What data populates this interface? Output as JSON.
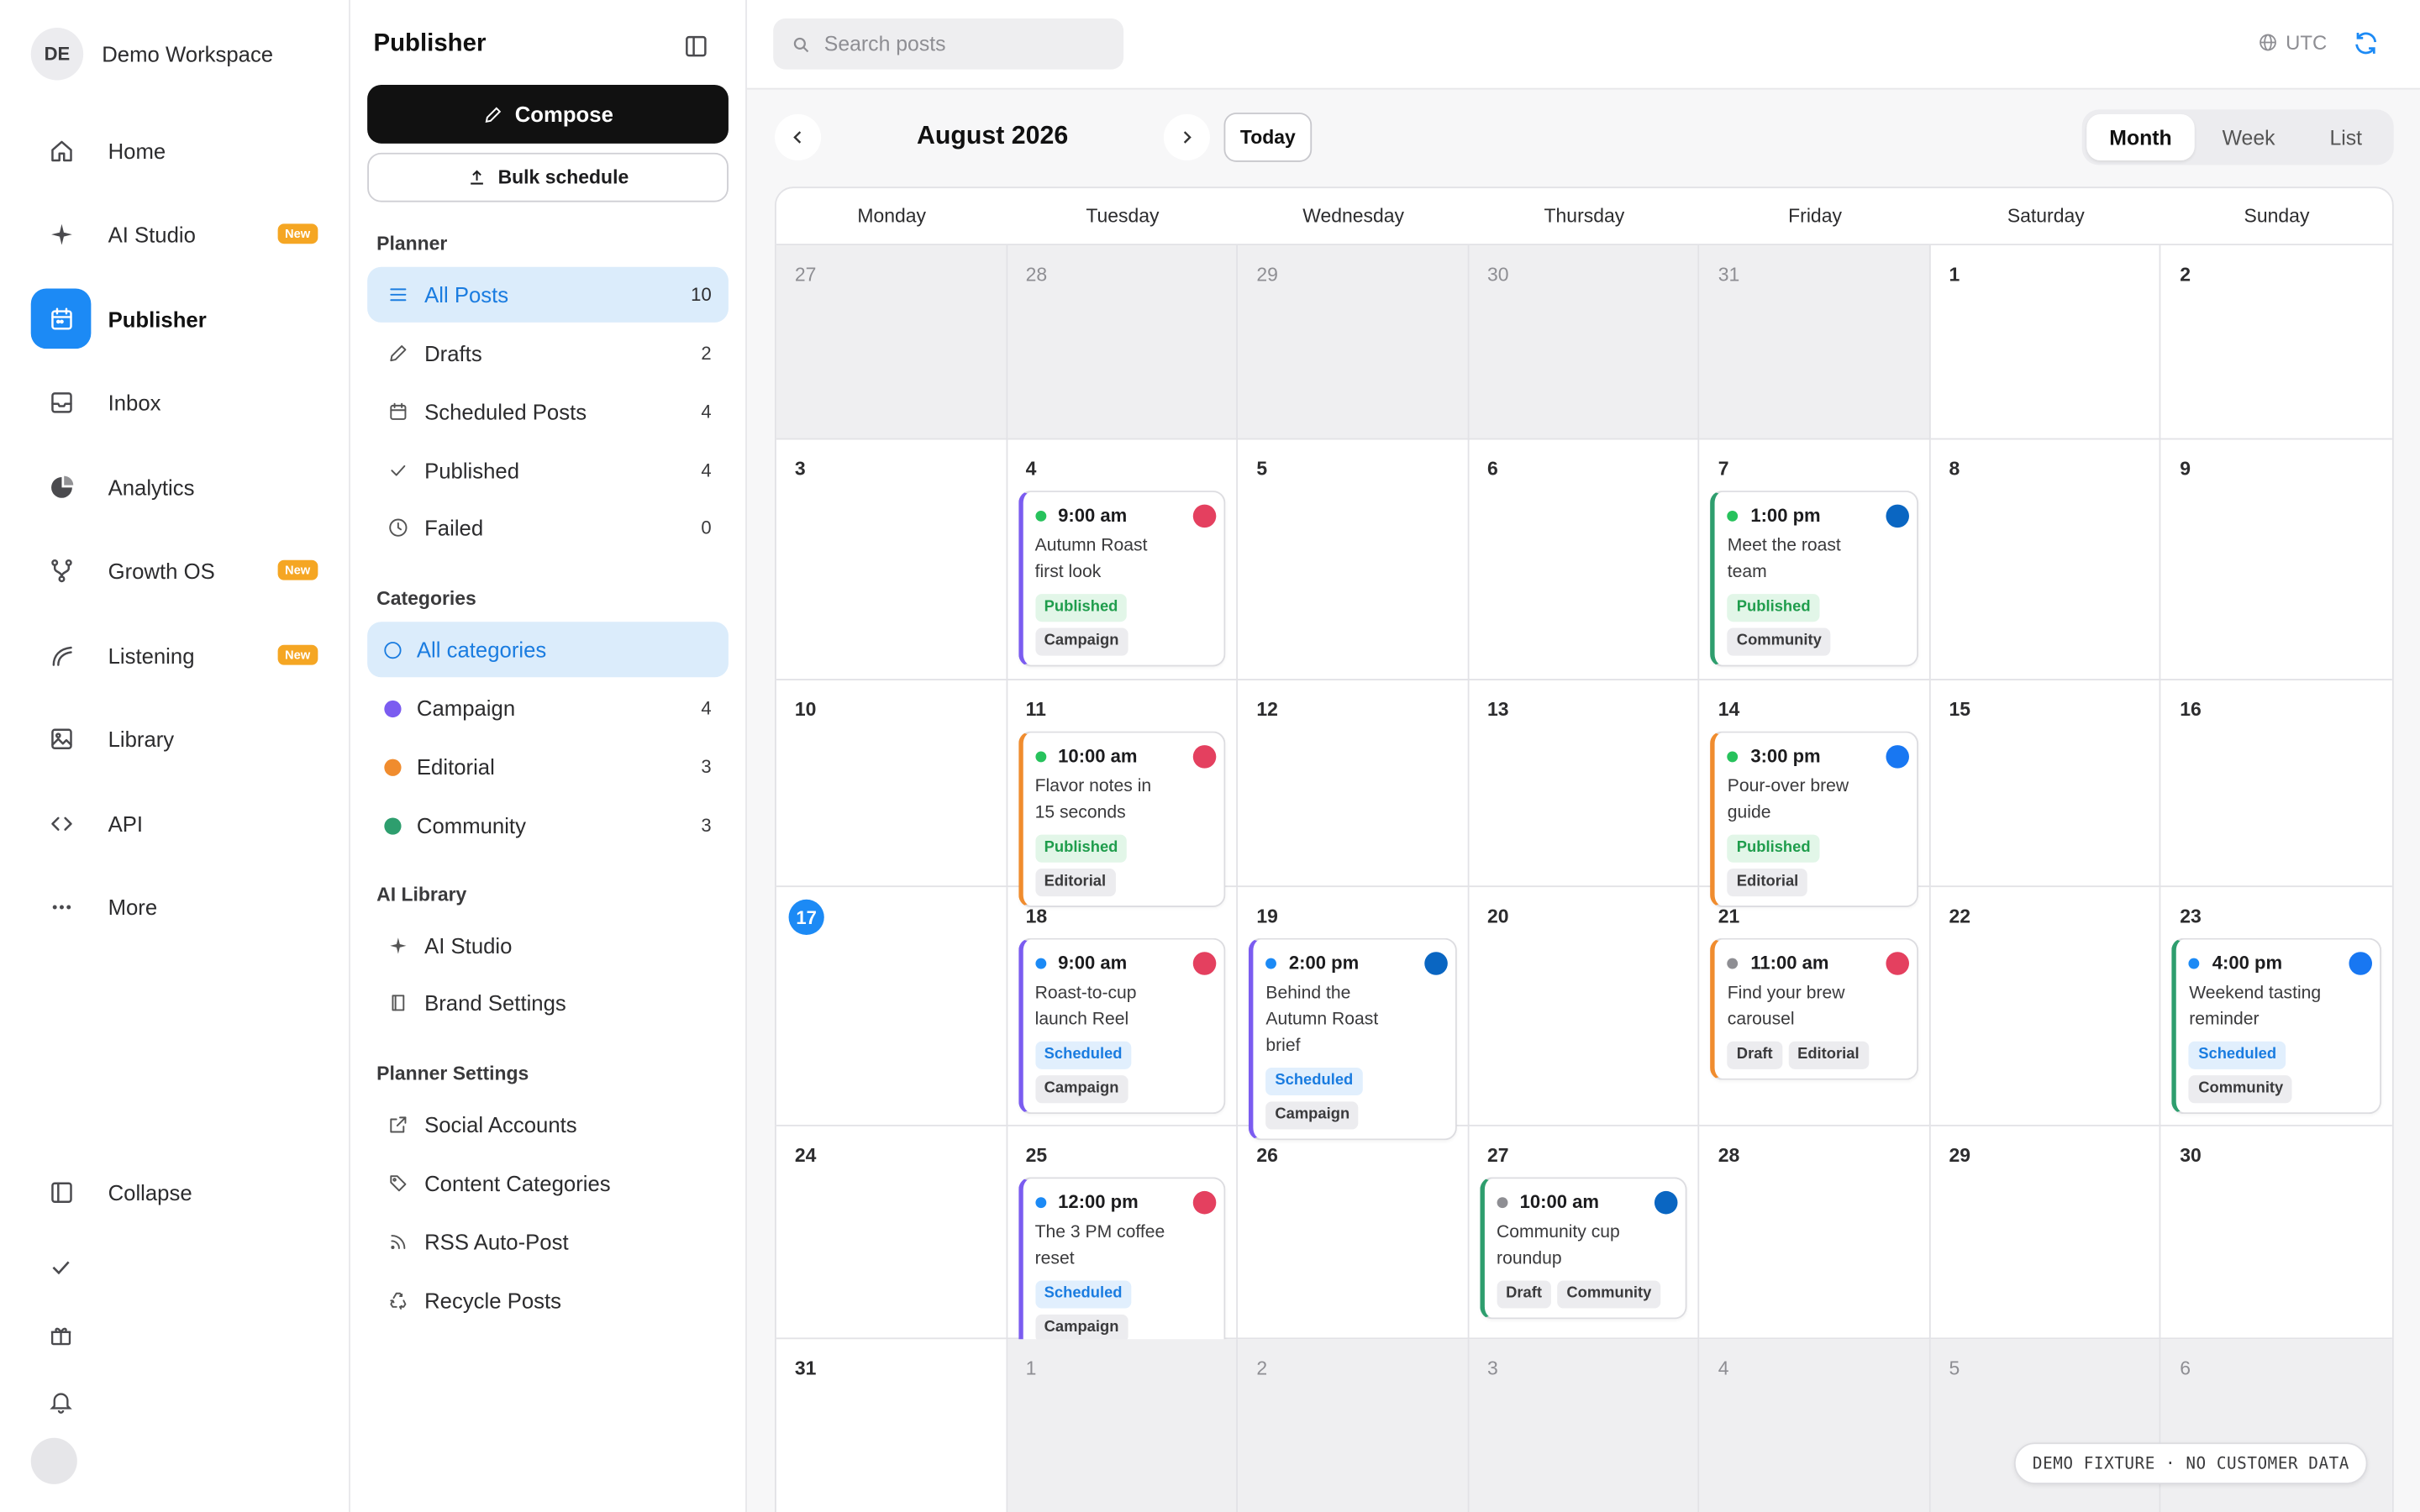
{
  "workspace": {
    "initials": "DE",
    "name": "Demo Workspace"
  },
  "nav": {
    "items": [
      {
        "key": "home",
        "label": "Home",
        "icon": "home-icon"
      },
      {
        "key": "ai-studio",
        "label": "AI Studio",
        "icon": "sparkle-icon",
        "badge": "New"
      },
      {
        "key": "publisher",
        "label": "Publisher",
        "icon": "calendar-icon",
        "active": true
      },
      {
        "key": "inbox",
        "label": "Inbox",
        "icon": "inbox-icon"
      },
      {
        "key": "analytics",
        "label": "Analytics",
        "icon": "pie-chart-icon"
      },
      {
        "key": "growth-os",
        "label": "Growth OS",
        "icon": "branch-icon",
        "badge": "New"
      },
      {
        "key": "listening",
        "label": "Listening",
        "icon": "wave-icon",
        "badge": "New"
      },
      {
        "key": "library",
        "label": "Library",
        "icon": "image-icon"
      },
      {
        "key": "api",
        "label": "API",
        "icon": "code-icon"
      },
      {
        "key": "more",
        "label": "More",
        "icon": "ellipsis-icon"
      }
    ],
    "collapse_label": "Collapse"
  },
  "panel": {
    "title": "Publisher",
    "compose_label": "Compose",
    "bulk_label": "Bulk schedule",
    "planner_title": "Planner",
    "planner_items": [
      {
        "label": "All Posts",
        "count": "10",
        "icon": "list-icon",
        "active": true
      },
      {
        "label": "Drafts",
        "count": "2",
        "icon": "pencil-icon"
      },
      {
        "label": "Scheduled Posts",
        "count": "4",
        "icon": "calendar-small-icon"
      },
      {
        "label": "Published",
        "count": "4",
        "icon": "check-icon"
      },
      {
        "label": "Failed",
        "count": "0",
        "icon": "clock-icon"
      }
    ],
    "categories_title": "Categories",
    "categories": [
      {
        "label": "All categories",
        "count": "",
        "active": true,
        "color": ""
      },
      {
        "label": "Campaign",
        "count": "4",
        "color": "#7b5cf0"
      },
      {
        "label": "Editorial",
        "count": "3",
        "color": "#f08c2e"
      },
      {
        "label": "Community",
        "count": "3",
        "color": "#2e9e6e"
      }
    ],
    "ai_library_title": "AI Library",
    "ai_library_items": [
      {
        "label": "AI Studio",
        "icon": "sparkle-icon"
      },
      {
        "label": "Brand Settings",
        "icon": "book-icon"
      }
    ],
    "settings_title": "Planner Settings",
    "settings_items": [
      {
        "label": "Social Accounts",
        "icon": "external-link-icon"
      },
      {
        "label": "Content Categories",
        "icon": "tag-icon"
      },
      {
        "label": "RSS Auto-Post",
        "icon": "rss-icon"
      },
      {
        "label": "Recycle Posts",
        "icon": "recycle-icon"
      }
    ]
  },
  "topbar": {
    "search_placeholder": "Search posts",
    "timezone": "UTC"
  },
  "calendar": {
    "month_title": "August 2026",
    "today_label": "Today",
    "views": [
      {
        "label": "Month",
        "active": true
      },
      {
        "label": "Week"
      },
      {
        "label": "List"
      }
    ],
    "weekdays": [
      "Monday",
      "Tuesday",
      "Wednesday",
      "Thursday",
      "Friday",
      "Saturday",
      "Sunday"
    ],
    "weeks": [
      [
        {
          "d": "27",
          "out": true
        },
        {
          "d": "28",
          "out": true
        },
        {
          "d": "29",
          "out": true
        },
        {
          "d": "30",
          "out": true
        },
        {
          "d": "31",
          "out": true
        },
        {
          "d": "1"
        },
        {
          "d": "2"
        }
      ],
      [
        {
          "d": "3"
        },
        {
          "d": "4",
          "post": {
            "time": "9:00 am",
            "title": "Autumn Roast first look",
            "status": "Published",
            "category": "Campaign",
            "status_color": "#27c25c",
            "bar": "#7b5cf0",
            "avatar": "#e4405f",
            "tags_inline": false
          }
        },
        {
          "d": "5"
        },
        {
          "d": "6"
        },
        {
          "d": "7",
          "post": {
            "time": "1:00 pm",
            "title": "Meet the roast team",
            "status": "Published",
            "category": "Community",
            "status_color": "#27c25c",
            "bar": "#2e9e6e",
            "avatar": "#0a66c2",
            "tags_inline": false
          }
        },
        {
          "d": "8"
        },
        {
          "d": "9"
        }
      ],
      [
        {
          "d": "10"
        },
        {
          "d": "11",
          "post": {
            "time": "10:00 am",
            "title": "Flavor notes in 15 seconds",
            "status": "Published",
            "category": "Editorial",
            "status_color": "#27c25c",
            "bar": "#f08c2e",
            "avatar": "#e4405f",
            "tags_inline": true
          }
        },
        {
          "d": "12"
        },
        {
          "d": "13"
        },
        {
          "d": "14",
          "post": {
            "time": "3:00 pm",
            "title": "Pour-over brew guide",
            "status": "Published",
            "category": "Editorial",
            "status_color": "#27c25c",
            "bar": "#f08c2e",
            "avatar": "#1877f2",
            "tags_inline": true
          }
        },
        {
          "d": "15"
        },
        {
          "d": "16"
        }
      ],
      [
        {
          "d": "17",
          "today": true
        },
        {
          "d": "18",
          "post": {
            "time": "9:00 am",
            "title": "Roast-to-cup launch Reel",
            "status": "Scheduled",
            "category": "Campaign",
            "status_color": "#1c8af5",
            "bar": "#7b5cf0",
            "avatar": "#e4405f",
            "tags_inline": false
          }
        },
        {
          "d": "19",
          "post": {
            "time": "2:00 pm",
            "title": "Behind the Autumn Roast brief",
            "status": "Scheduled",
            "category": "Campaign",
            "status_color": "#1c8af5",
            "bar": "#7b5cf0",
            "avatar": "#0a66c2",
            "tags_inline": false
          }
        },
        {
          "d": "20"
        },
        {
          "d": "21",
          "post": {
            "time": "11:00 am",
            "title": "Find your brew carousel",
            "status": "Draft",
            "category": "Editorial",
            "status_color": "#8e8e93",
            "bar": "#f08c2e",
            "avatar": "#e4405f",
            "tags_inline": true
          }
        },
        {
          "d": "22"
        },
        {
          "d": "23",
          "post": {
            "time": "4:00 pm",
            "title": "Weekend tasting reminder",
            "status": "Scheduled",
            "category": "Community",
            "status_color": "#1c8af5",
            "bar": "#2e9e6e",
            "avatar": "#1877f2",
            "tags_inline": false
          }
        }
      ],
      [
        {
          "d": "24"
        },
        {
          "d": "25",
          "post": {
            "time": "12:00 pm",
            "title": "The 3 PM coffee reset",
            "status": "Scheduled",
            "category": "Campaign",
            "status_color": "#1c8af5",
            "bar": "#7b5cf0",
            "avatar": "#e4405f",
            "tags_inline": false
          }
        },
        {
          "d": "26"
        },
        {
          "d": "27",
          "post": {
            "time": "10:00 am",
            "title": "Community cup roundup",
            "status": "Draft",
            "category": "Community",
            "status_color": "#8e8e93",
            "bar": "#2e9e6e",
            "avatar": "#0a66c2",
            "tags_inline": true
          }
        },
        {
          "d": "28"
        },
        {
          "d": "29"
        },
        {
          "d": "30"
        }
      ],
      [
        {
          "d": "31"
        },
        {
          "d": "1",
          "out": true
        },
        {
          "d": "2",
          "out": true
        },
        {
          "d": "3",
          "out": true
        },
        {
          "d": "4",
          "out": true
        },
        {
          "d": "5",
          "out": true
        },
        {
          "d": "6",
          "out": true
        }
      ]
    ]
  },
  "fixture_label": "DEMO FIXTURE · NO CUSTOMER DATA",
  "colors": {
    "accent": "#1c8af5",
    "compose": "#111111",
    "new_badge": "#f5a623"
  }
}
